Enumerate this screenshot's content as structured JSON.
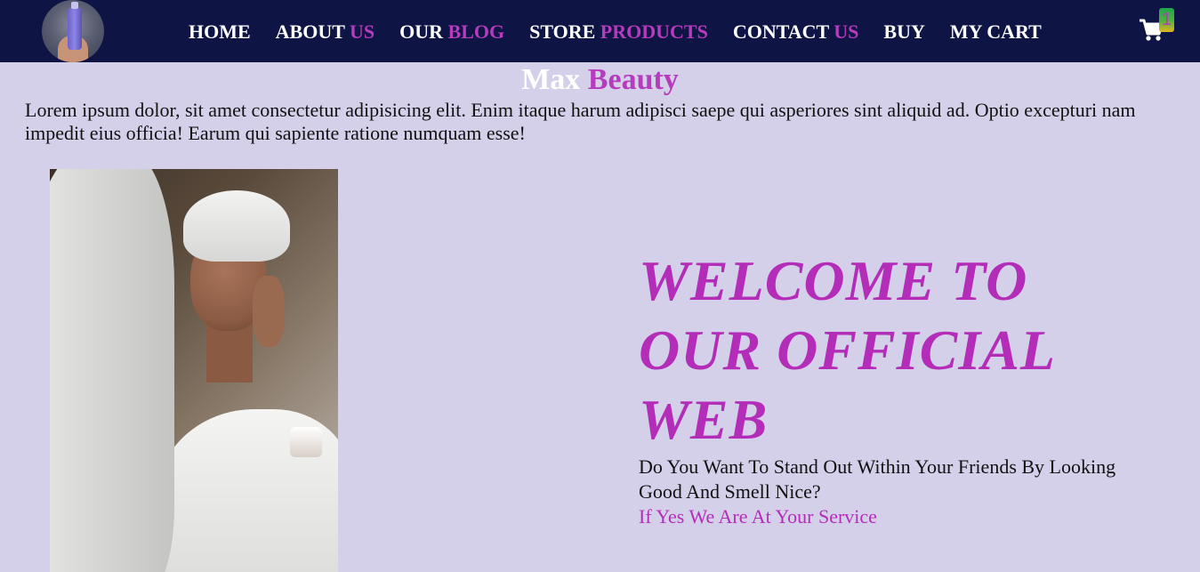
{
  "nav": {
    "logo_icon": "lotion-bottle-logo",
    "items": [
      {
        "main": "HOME",
        "accent": ""
      },
      {
        "main": "ABOUT ",
        "accent": "US"
      },
      {
        "main": "OUR ",
        "accent": "BLOG"
      },
      {
        "main": "STORE ",
        "accent": "PRODUCTS"
      },
      {
        "main": "CONTACT ",
        "accent": "US"
      },
      {
        "main": "BUY",
        "accent": ""
      },
      {
        "main": "MY CART",
        "accent": ""
      }
    ],
    "cart_icon": "shopping-cart-icon",
    "cart_count": "1"
  },
  "brand": {
    "part1": "Max ",
    "part2": "Beauty"
  },
  "intro": "Lorem ipsum dolor, sit amet consectetur adipisicing elit. Enim itaque harum adipisci saepe qui asperiores sint aliquid ad. Optio excepturi nam impedit eius officia! Earum qui sapiente ratione numquam esse!",
  "hero": {
    "image": "woman-applying-skincare-photo",
    "title": "WELCOME TO OUR OFFICIAL WEB",
    "subtitle": "Do You Want To Stand Out Within Your Friends By Looking Good And Smell Nice?",
    "service": "If Yes We Are At Your Service"
  },
  "colors": {
    "navbar": "#0e1444",
    "background": "#d4d0ea",
    "accent": "#b63bbd"
  }
}
